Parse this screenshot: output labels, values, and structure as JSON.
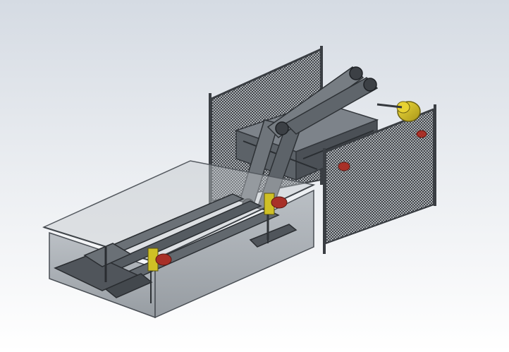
{
  "viewport": {
    "background_top": "#d5dbe3",
    "background_bottom": "#ffffff"
  },
  "model": {
    "components": [
      "rear-fence-panel",
      "right-fence-panel",
      "glass-tank",
      "inclined-conveyor-arms",
      "horizontal-rails",
      "gear-motor-left",
      "gear-motor-right",
      "gear-motor-rear",
      "yellow-spool",
      "base-frame"
    ],
    "colors": {
      "steel": "#5a5f66",
      "steel_dark": "#34383d",
      "glass": "#8f969d",
      "mesh": "#2e3236",
      "yellow": "#d7c21f",
      "red": "#b0322a"
    }
  }
}
